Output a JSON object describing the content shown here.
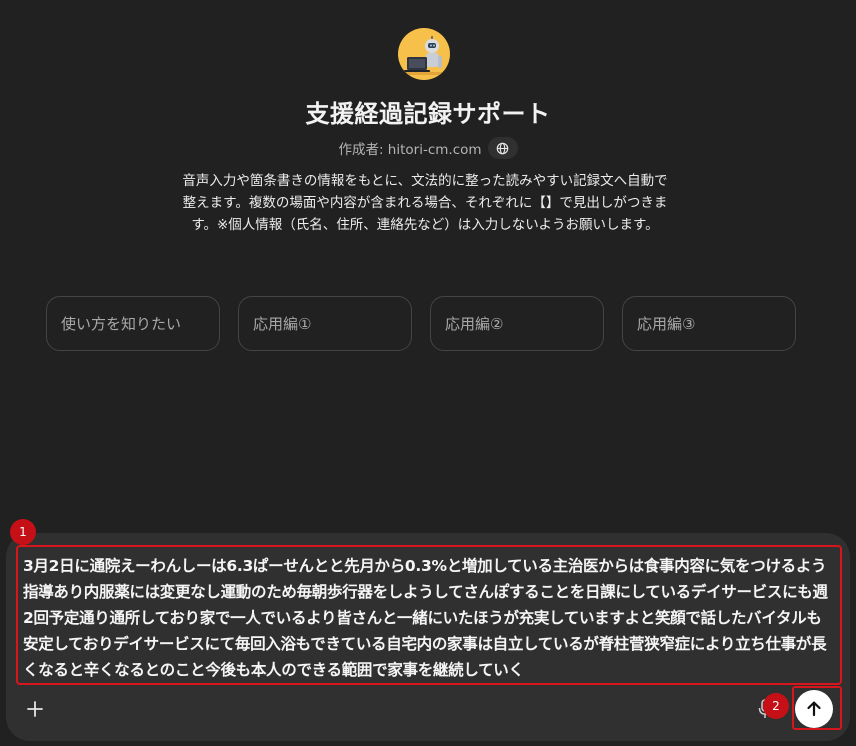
{
  "gpt": {
    "title": "支援経過記録サポート",
    "author": "作成者: hitori-cm.com",
    "description": "音声入力や箇条書きの情報をもとに、文法的に整った読みやすい記録文へ自動で整えます。複数の場面や内容が含まれる場合、それぞれに【】で見出しがつきます。※個人情報（氏名、住所、連絡先など）は入力しないようお願いします。"
  },
  "starters": [
    {
      "label": "使い方を知りたい"
    },
    {
      "label": "応用編①"
    },
    {
      "label": "応用編②"
    },
    {
      "label": "応用編③"
    }
  ],
  "composer": {
    "text": "3月2日に通院えーわんしーは6.3ぱーせんとと先月から0.3%と増加している主治医からは食事内容に気をつけるよう指導あり内服薬には変更なし運動のため毎朝歩行器をしようしてさんぽすることを日課にしているデイサービスにも週2回予定通り通所しており家で一人でいるより皆さんと一緒にいたほうが充実していますよと笑顔で話したバイタルも安定しておりデイサービスにて毎回入浴もできている自宅内の家事は自立しているが脊柱菅狭窄症により立ち仕事が長くなると辛くなるとのこと今後も本人のできる範囲で家事を継続していく"
  },
  "annotations": {
    "marker1": "1",
    "marker2": "2"
  },
  "icons": {
    "avatar": "robot-laptop-icon",
    "globe": "globe-icon",
    "plus": "plus-icon",
    "mic": "microphone-icon",
    "send": "arrow-up-icon"
  },
  "colors": {
    "background": "#212121",
    "composer": "#303030",
    "annotation_red": "#d7151c",
    "avatar_bg": "#f6c04a"
  }
}
